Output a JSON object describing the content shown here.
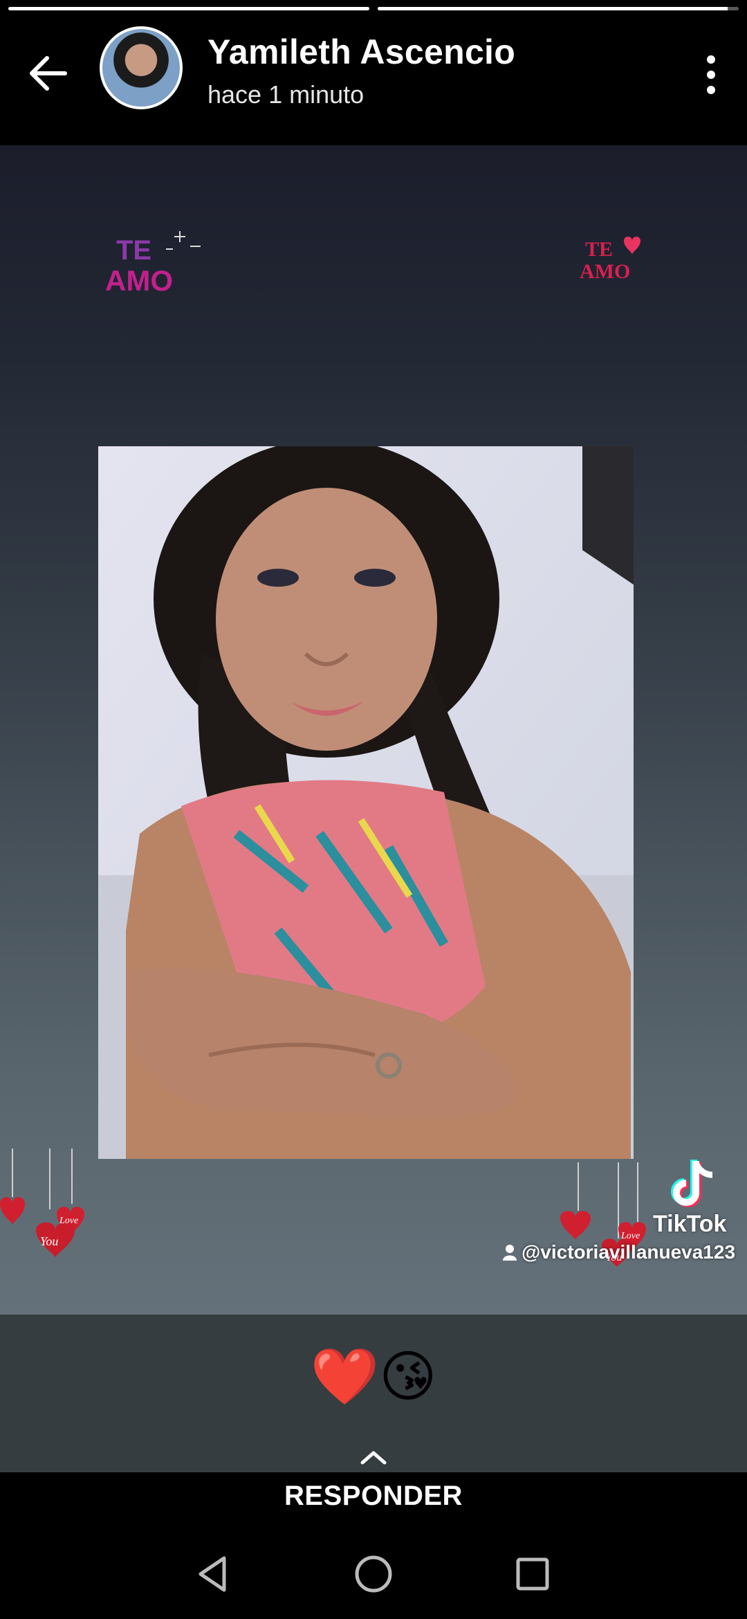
{
  "story": {
    "progress": [
      1.0,
      0.97
    ],
    "user_name": "Yamileth Ascencio",
    "time_ago": "hace 1 minuto",
    "caption_emojis": "❤️😘",
    "stickers": {
      "left_text": "TE AMO",
      "right_text": "TE AMO"
    },
    "watermark": {
      "app": "TikTok",
      "username": "@victoriavillanueva123"
    },
    "hearts_text": [
      "Love",
      "You"
    ]
  },
  "reply": {
    "label": "RESPONDER"
  },
  "colors": {
    "background": "#000000",
    "caption_band": "#353d40",
    "accent_pink": "#e0267a",
    "tiktok_cyan": "#25f4ee",
    "tiktok_red": "#fe2c55"
  },
  "icons": {
    "back": "arrow-left-icon",
    "menu": "more-vertical-icon",
    "reply": "chevron-up-icon",
    "nav_back": "nav-back-icon",
    "nav_home": "nav-home-icon",
    "nav_recents": "nav-recents-icon"
  }
}
